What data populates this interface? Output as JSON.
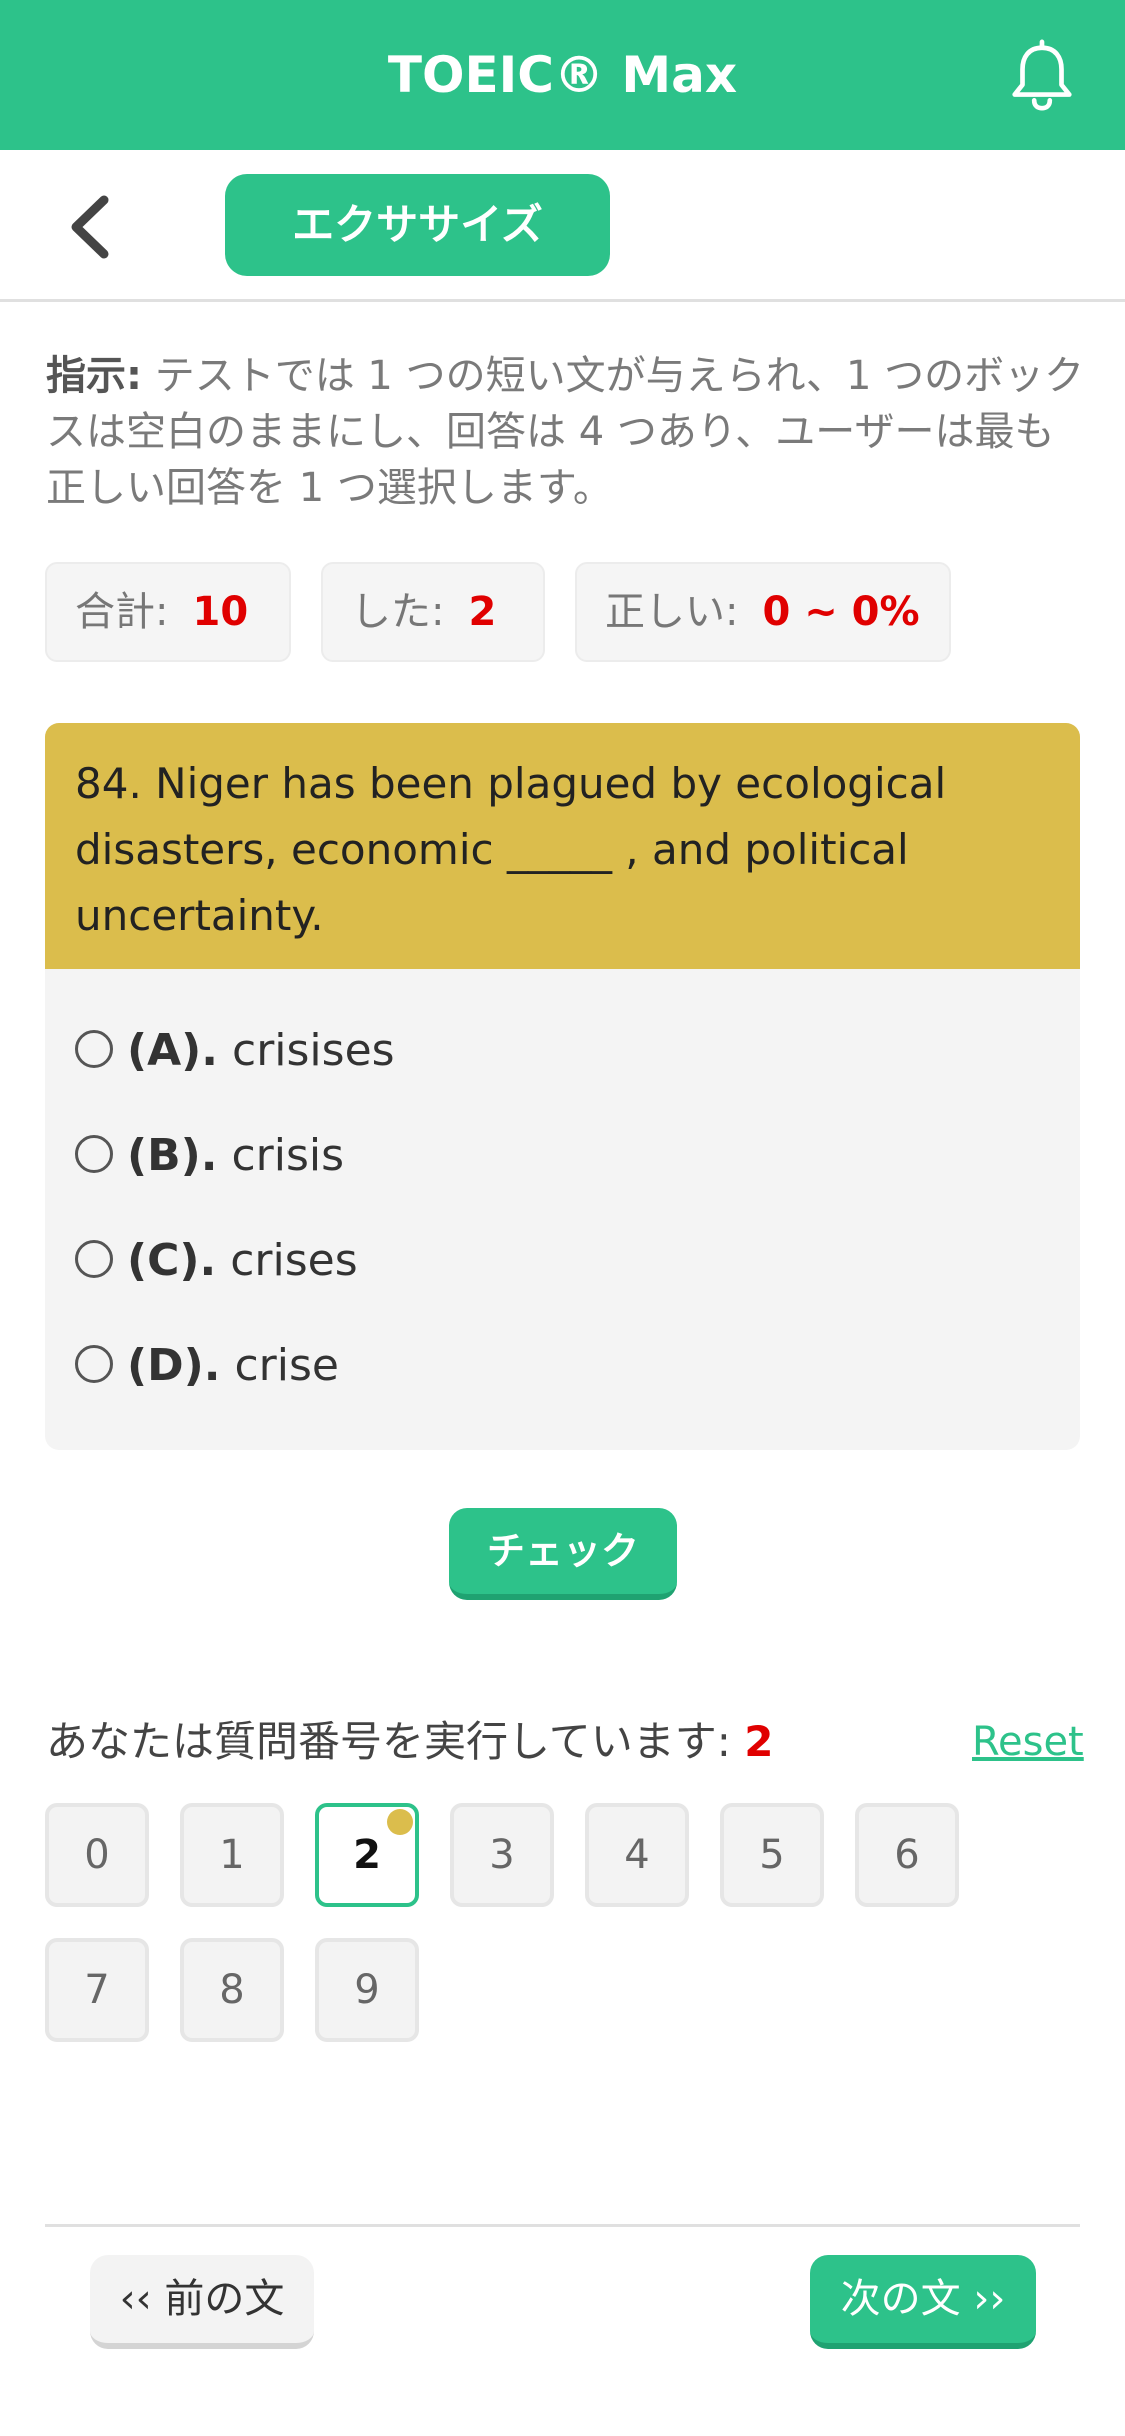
{
  "app": {
    "title": "TOEIC® Max"
  },
  "header": {
    "exercise_label": "エクササイズ"
  },
  "instruction": {
    "label": "指示:",
    "text": " テストでは 1 つの短い文が与えられ、1 つのボックスは空白のままにし、回答は 4 つあり、ユーザーは最も正しい回答を 1 つ選択します。"
  },
  "stats": [
    {
      "label": "合計:",
      "value": "10"
    },
    {
      "label": "した:",
      "value": "2"
    },
    {
      "label": "正しい:",
      "value": "0 ~ 0%"
    }
  ],
  "question": {
    "text": "84. Niger has been plagued by ecological disasters, economic _____ , and political uncertainty.",
    "options": [
      {
        "key": "(A).",
        "text": "crisises"
      },
      {
        "key": "(B).",
        "text": "crisis"
      },
      {
        "key": "(C).",
        "text": "crises"
      },
      {
        "key": "(D).",
        "text": "crise"
      }
    ]
  },
  "check_label": "チェック",
  "progress": {
    "label": "あなたは質問番号を実行しています: ",
    "current": "2",
    "reset_label": "Reset",
    "numbers": [
      "0",
      "1",
      "2",
      "3",
      "4",
      "5",
      "6",
      "7",
      "8",
      "9"
    ]
  },
  "nav": {
    "prev_label": "‹‹ 前の文",
    "next_label": "次の文 ››"
  },
  "colors": {
    "accent": "#2dc28a",
    "question_bg": "#dbbd4c",
    "highlight": "#e00000"
  },
  "icons": {
    "bell": "bell-icon",
    "back": "chevron-left-icon"
  }
}
